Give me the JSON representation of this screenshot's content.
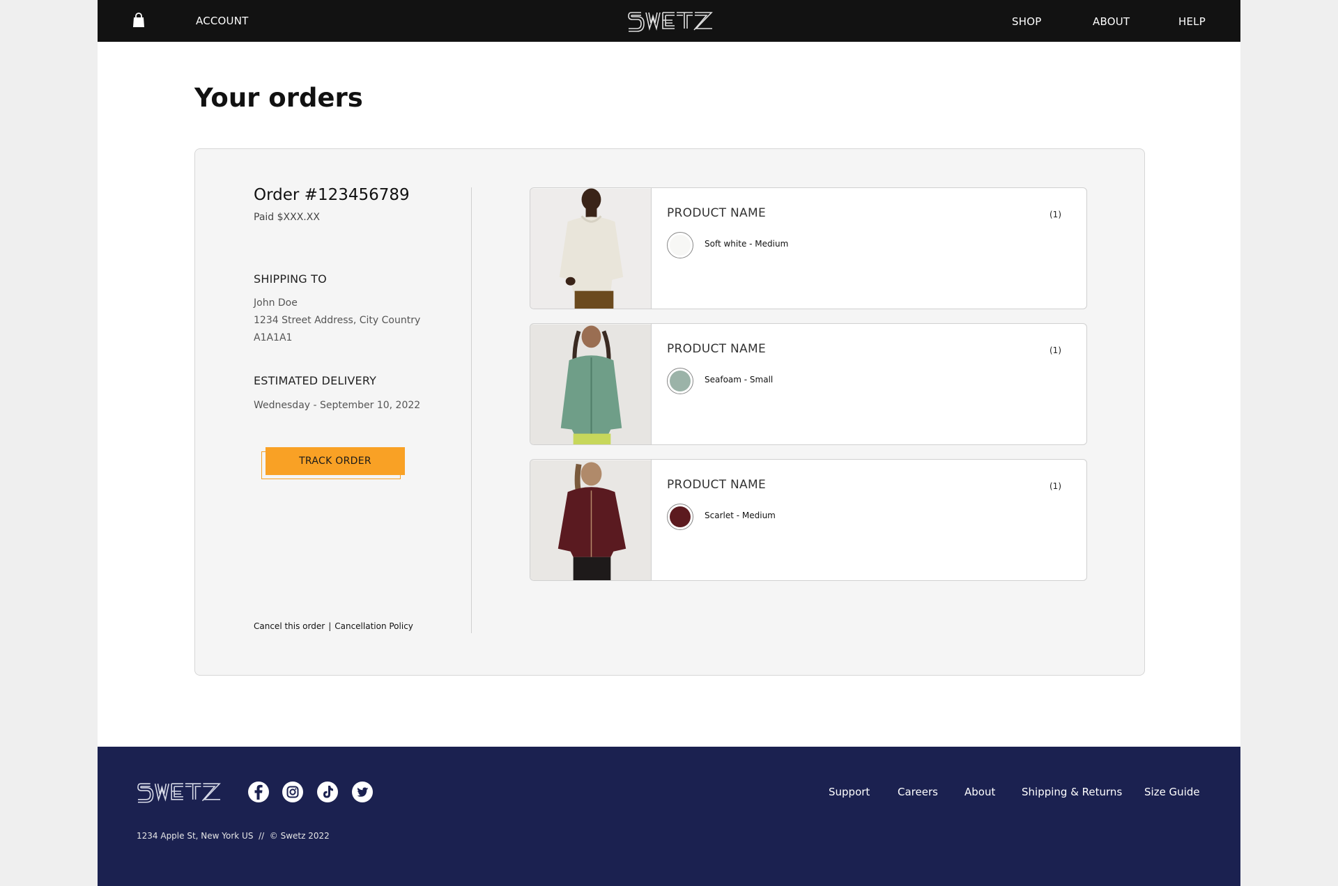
{
  "header": {
    "account_label": "ACCOUNT",
    "brand": "SWETZ",
    "nav": {
      "shop": "SHOP",
      "about": "ABOUT",
      "help": "HELP"
    }
  },
  "page_title": "Your orders",
  "order": {
    "number": "Order #123456789",
    "paid": "Paid $XXX.XX",
    "shipping_heading": "SHIPPING TO",
    "address": [
      "John Doe",
      "1234 Street Address, City Country",
      "A1A1A1"
    ],
    "delivery_heading": "ESTIMATED DELIVERY",
    "delivery_date": "Wednesday - September 10, 2022",
    "track_label": "TRACK ORDER",
    "cancel_label": "Cancel this order",
    "separator": "|",
    "policy_label": "Cancellation Policy"
  },
  "products": [
    {
      "name": "PRODUCT NAME",
      "qty": "(1)",
      "variant": "Soft white - Medium",
      "color": "#f7f7f5",
      "image": "man-in-white-hoodie"
    },
    {
      "name": "PRODUCT NAME",
      "qty": "(1)",
      "variant": "Seafoam - Small",
      "color": "#9bb3a8",
      "image": "woman-in-green-jacket"
    },
    {
      "name": "PRODUCT NAME",
      "qty": "(1)",
      "variant": "Scarlet - Medium",
      "color": "#5c1a1f",
      "image": "woman-in-scarlet-hoodie"
    }
  ],
  "footer": {
    "brand": "SWETZ",
    "social": [
      "facebook-icon",
      "instagram-icon",
      "tiktok-icon",
      "twitter-icon"
    ],
    "links": {
      "support": "Support",
      "careers": "Careers",
      "about": "About",
      "shipping": "Shipping & Returns",
      "size": "Size Guide"
    },
    "address": "1234 Apple St, New York US  //  © Swetz 2022"
  },
  "colors": {
    "header_bg": "#121212",
    "footer_bg": "#1b2150",
    "accent": "#f9a125",
    "card_bg": "#f5f5f5"
  }
}
